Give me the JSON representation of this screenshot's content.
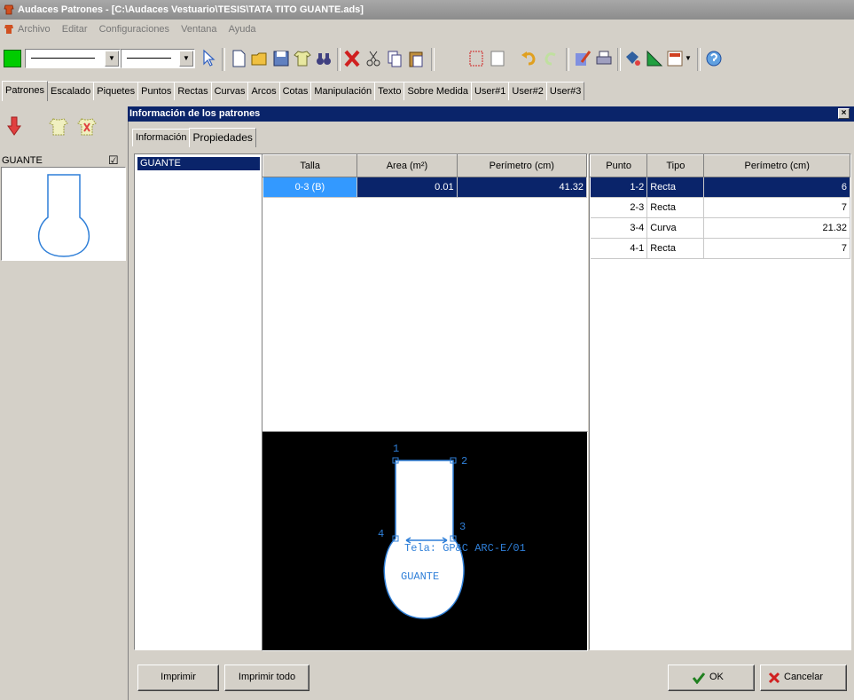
{
  "window": {
    "title": "Audaces Patrones - [C:\\Audaces Vestuario\\TESIS\\TATA TITO GUANTE.ads]"
  },
  "menu": [
    "Archivo",
    "Editar",
    "Configuraciones",
    "Ventana",
    "Ayuda"
  ],
  "tabs": [
    "Patrones",
    "Escalado",
    "Piquetes",
    "Puntos",
    "Rectas",
    "Curvas",
    "Arcos",
    "Cotas",
    "Manipulación",
    "Texto",
    "Sobre Medida",
    "User#1",
    "User#2",
    "User#3"
  ],
  "left_panel": {
    "pattern_name": "GUANTE",
    "check_mark": "☑"
  },
  "dialog": {
    "title": "Información de los patrones",
    "close_glyph": "×",
    "subtabs": [
      "Información",
      "Propiedades"
    ],
    "pattern_list": [
      "GUANTE"
    ],
    "sizes_table": {
      "headers": [
        "Talla",
        "Area (m²)",
        "Perímetro (cm)"
      ],
      "rows": [
        [
          "0-3 (B)",
          "0.01",
          "41.32"
        ]
      ]
    },
    "segments_table": {
      "headers": [
        "Punto",
        "Tipo",
        "Perímetro (cm)"
      ],
      "rows": [
        [
          "1-2",
          "Recta",
          "6"
        ],
        [
          "2-3",
          "Recta",
          "7"
        ],
        [
          "3-4",
          "Curva",
          "21.32"
        ],
        [
          "4-1",
          "Recta",
          "7"
        ]
      ]
    },
    "preview": {
      "point_labels": [
        "1",
        "2",
        "3",
        "4"
      ],
      "fabric_label": "Tela: GP&C ARC-E/01",
      "piece_name": "GUANTE"
    },
    "buttons": {
      "print": "Imprimir",
      "print_all": "Imprimir todo",
      "ok": "OK",
      "cancel": "Cancelar"
    }
  },
  "colors": {
    "selection": "#0a246a",
    "preview_bg": "#000000",
    "preview_line": "#2f7fd8",
    "brand_green": "#00cc00"
  }
}
